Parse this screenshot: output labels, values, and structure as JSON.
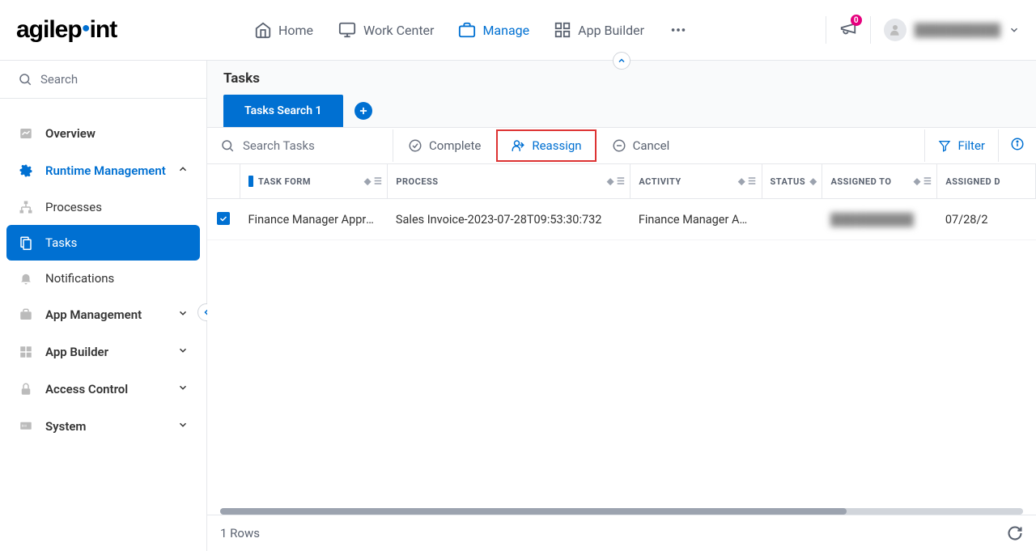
{
  "topnav": {
    "logo_text_a": "agilep",
    "logo_text_b": "int",
    "items": [
      {
        "label": "Home"
      },
      {
        "label": "Work Center"
      },
      {
        "label": "Manage"
      },
      {
        "label": "App Builder"
      }
    ],
    "badge_count": "0",
    "profile_name": "██████████"
  },
  "sidebar": {
    "search_placeholder": "Search",
    "items": [
      {
        "label": "Overview"
      },
      {
        "label": "Runtime Management",
        "expanded": true
      },
      {
        "label": "App Management"
      },
      {
        "label": "App Builder"
      },
      {
        "label": "Access Control"
      },
      {
        "label": "System"
      }
    ],
    "runtime_subs": [
      {
        "label": "Processes"
      },
      {
        "label": "Tasks"
      },
      {
        "label": "Notifications"
      }
    ]
  },
  "main": {
    "title": "Tasks",
    "tab_label": "Tasks Search 1",
    "search_placeholder": "Search Tasks",
    "actions": {
      "complete": "Complete",
      "reassign": "Reassign",
      "cancel": "Cancel"
    },
    "filter_label": "Filter",
    "columns": {
      "task_form": "TASK FORM",
      "process": "PROCESS",
      "activity": "ACTIVITY",
      "status": "STATUS",
      "assigned_to": "ASSIGNED TO",
      "assigned_date": "ASSIGNED D"
    },
    "rows": [
      {
        "task_form": "Finance Manager Appro…",
        "process": "Sales Invoice-2023-07-28T09:53:30:732",
        "activity": "Finance Manager A…",
        "status": "",
        "assigned_to": "██████████",
        "assigned_date": "07/28/2"
      }
    ],
    "row_count": "1 Rows"
  }
}
